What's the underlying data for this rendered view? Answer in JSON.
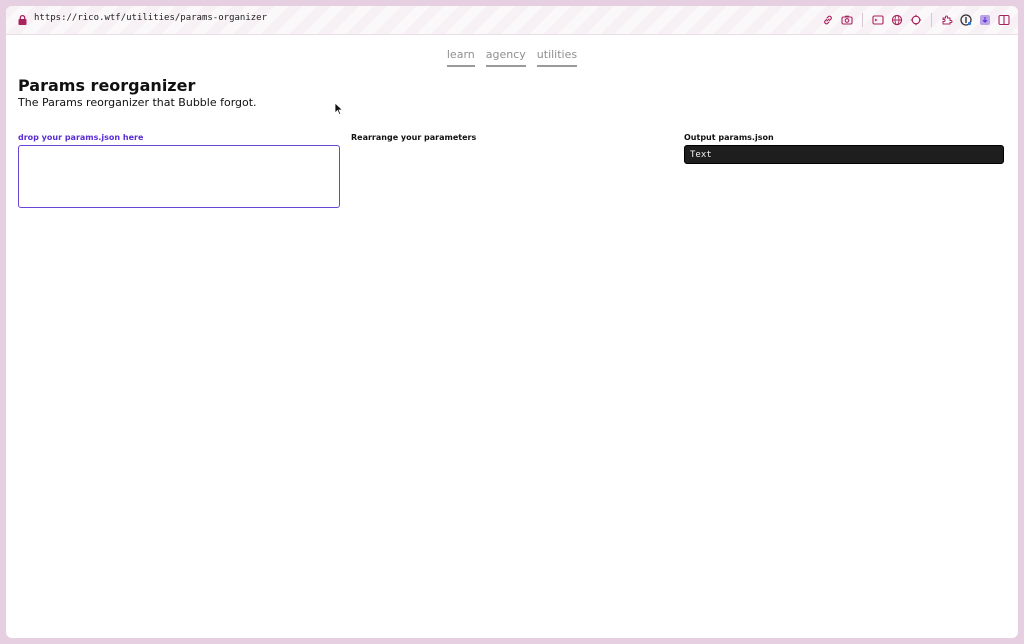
{
  "browser": {
    "url": "https://rico.wtf/utilities/params-organizer",
    "toolbar_icons": [
      "link-icon",
      "camera-icon",
      "terminal-icon",
      "globe-icon",
      "crosshair-icon",
      "extension-icon",
      "onepassword-icon",
      "download-icon",
      "sidebar-icon"
    ],
    "accent_color": "#a8235e"
  },
  "nav": {
    "items": [
      {
        "label": "learn"
      },
      {
        "label": "agency"
      },
      {
        "label": "utilities"
      }
    ]
  },
  "page": {
    "title": "Params reorganizer",
    "subtitle": "The Params reorganizer that Bubble forgot."
  },
  "columns": {
    "input_label": "drop your params.json here",
    "rearrange_label": "Rearrange your parameters",
    "output_label": "Output params.json",
    "output_value": "Text"
  },
  "colors": {
    "dropzone_border": "#6b45d8",
    "output_background": "#1e1e1e",
    "window_frame": "#e6cfe0"
  }
}
